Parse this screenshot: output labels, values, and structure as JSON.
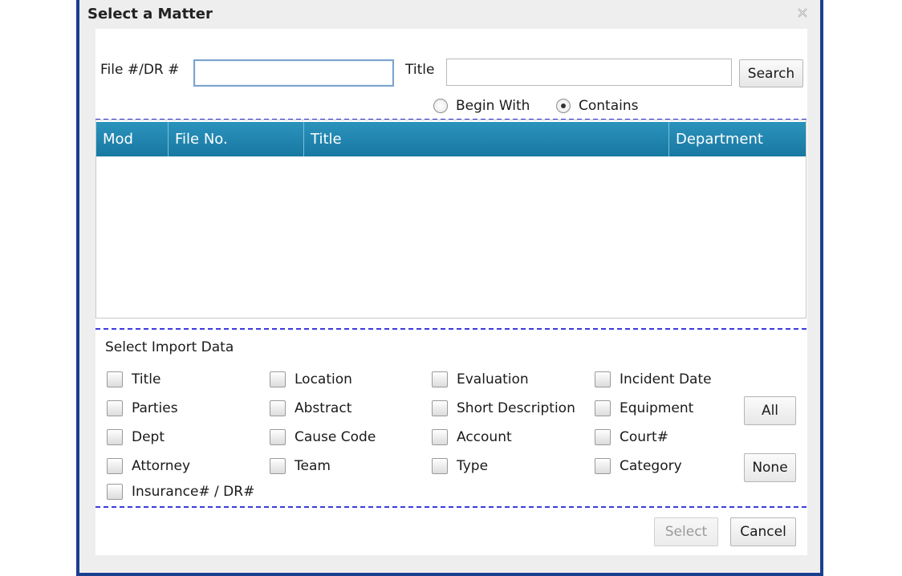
{
  "dialog": {
    "title": "Select a Matter"
  },
  "search": {
    "file_label": "File #/DR #",
    "file_value": "",
    "title_label": "Title",
    "title_value": "",
    "search_button": "Search",
    "options": [
      {
        "label": "Begin With",
        "selected": false
      },
      {
        "label": "Contains",
        "selected": true
      }
    ]
  },
  "grid": {
    "columns": [
      "Mod",
      "File No.",
      "Title",
      "Department"
    ],
    "rows": []
  },
  "import": {
    "title": "Select Import Data",
    "checkboxes": [
      {
        "label": "Title",
        "checked": false
      },
      {
        "label": "Location",
        "checked": false
      },
      {
        "label": "Evaluation",
        "checked": false
      },
      {
        "label": "Incident Date",
        "checked": false
      },
      {
        "label": "Parties",
        "checked": false
      },
      {
        "label": "Abstract",
        "checked": false
      },
      {
        "label": "Short Description",
        "checked": false
      },
      {
        "label": "Equipment",
        "checked": false
      },
      {
        "label": "Dept",
        "checked": false
      },
      {
        "label": "Cause Code",
        "checked": false
      },
      {
        "label": "Account",
        "checked": false
      },
      {
        "label": "Court#",
        "checked": false
      },
      {
        "label": "Attorney",
        "checked": false
      },
      {
        "label": "Team",
        "checked": false
      },
      {
        "label": "Type",
        "checked": false
      },
      {
        "label": "Category",
        "checked": false
      },
      {
        "label": "Insurance# / DR#",
        "checked": false
      }
    ],
    "all_button": "All",
    "none_button": "None"
  },
  "footer": {
    "select_button": "Select",
    "cancel_button": "Cancel"
  },
  "colors": {
    "header_bg": "#1878a2",
    "border_accent": "#1b3f8f",
    "separator": "#3b3bd9"
  }
}
